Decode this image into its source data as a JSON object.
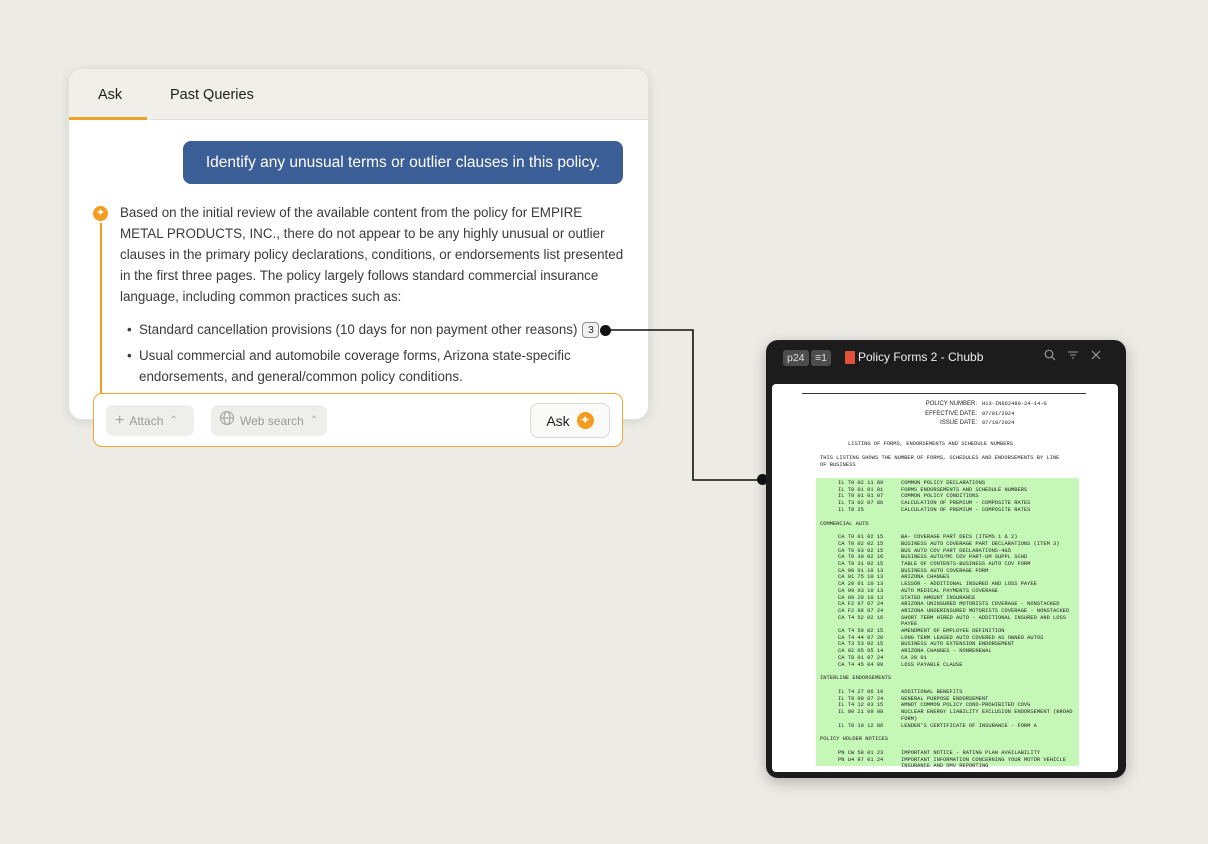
{
  "chat": {
    "tabs": [
      {
        "label": "Ask",
        "active": true
      },
      {
        "label": "Past Queries",
        "active": false
      }
    ],
    "user_query": "Identify any unusual terms or outlier clauses in this policy.",
    "response_intro": "Based on the initial review of the available content from the policy for EMPIRE METAL PRODUCTS, INC., there do not appear to be any highly unusual or outlier clauses in the primary policy declarations, conditions, or endorsements list presented in the first three pages. The policy largely follows standard commercial insurance language, including common practices such as:",
    "bullets": [
      {
        "text": "Standard cancellation provisions (10 days for non payment other reasons)",
        "citation": "3"
      },
      {
        "text": "Usual commercial and automobile coverage forms, Arizona state-specific endorsements, and general/common policy conditions.",
        "citation": ""
      }
    ],
    "input": {
      "attach_label": "Attach",
      "web_search_label": "Web search",
      "ask_label": "Ask"
    },
    "icons": {
      "ai_marker": "sparkle-icon",
      "ask": "sparkle-icon",
      "attach": "plus-icon",
      "web": "globe-icon"
    },
    "colors": {
      "accent": "#f39c20",
      "user_bubble": "#3b5e97"
    }
  },
  "viewer": {
    "page_badge": "p24",
    "section_badge": "1",
    "title": "Policy Forms 2 - Chubb",
    "icons": [
      "search-icon",
      "filter-icon",
      "close-icon"
    ],
    "doc": {
      "header": [
        {
          "label": "POLICY NUMBER:",
          "value": "H13-IN862480-24-14-G"
        },
        {
          "label": "EFFECTIVE DATE:",
          "value": "07/01/2024"
        },
        {
          "label": "ISSUE DATE:",
          "value": "07/10/2024"
        }
      ],
      "heading": "LISTING OF FORMS, ENDORSEMENTS AND SCHEDULE NUMBERS",
      "intro": "THIS LISTING SHOWS THE NUMBER OF FORMS, SCHEDULES AND ENDORSEMENTS BY LINE OF BUSINESS",
      "highlight_color": "#c5f7b7",
      "lines": [
        {
          "code": "IL T0 02 11 89",
          "desc": "COMMON POLICY DECLARATIONS"
        },
        {
          "code": "IL T8 01 01 01",
          "desc": "FORMS ENDORSEMENTS AND SCHEDULE NUMBERS"
        },
        {
          "code": "IL T0 01 01 07",
          "desc": "COMMON POLICY CONDITIONS"
        },
        {
          "code": "IL T3 02 07 86",
          "desc": "CALCULATION OF PREMIUM - COMPOSITE RATES"
        },
        {
          "code": "IL T8 25",
          "desc": "CALCULATION OF PREMIUM - COMPOSITE RATES"
        },
        {
          "section": "COMMERCIAL AUTO"
        },
        {
          "code": "CA T0 01 02 15",
          "desc": "BA- COVERAGE PART DECS (ITEMS 1 & 2)"
        },
        {
          "code": "CA T0 02 02 15",
          "desc": "BUSINESS AUTO COVERAGE PART DECLARATIONS (ITEM 3)"
        },
        {
          "code": "CA T0 03 02 15",
          "desc": "BUS AUTO COV PART DECLARATIONS-4&5"
        },
        {
          "code": "CA T0 30 02 16",
          "desc": "BUSINESS AUTO/MC COV PART-UM SUPPL SCHD"
        },
        {
          "code": "CA T0 31 02 15",
          "desc": "TABLE OF CONTENTS-BUSINESS AUTO COV FORM"
        },
        {
          "code": "CA 00 01 10 13",
          "desc": "BUSINESS AUTO COVERAGE FORM"
        },
        {
          "code": "CA 01 75 10 13",
          "desc": "ARIZONA CHANGES"
        },
        {
          "code": "CA 20 01 10 13",
          "desc": "LESSOR - ADDITIONAL INSURED AND LOSS PAYEE"
        },
        {
          "code": "CA 99 03 10 13",
          "desc": "AUTO MEDICAL PAYMENTS COVERAGE"
        },
        {
          "code": "CA 99 28 10 13",
          "desc": "STATED AMOUNT INSURANCE"
        },
        {
          "code": "CA F2 97 07 24",
          "desc": "ARIZONA UNINSURED MOTORISTS COVERAGE - NONSTACKED"
        },
        {
          "code": "CA F2 98 07 24",
          "desc": "ARIZONA UNDERINSURED MOTORISTS COVERAGE - NONSTACKED"
        },
        {
          "code": "CA T4 52 02 16",
          "desc": "SHORT TERM HIRED AUTO - ADDITIONAL INSURED AND LOSS PAYEE"
        },
        {
          "code": "CA T4 59 02 15",
          "desc": "AMENDMENT OF EMPLOYEE DEFINITION"
        },
        {
          "code": "CA T4 44 07 20",
          "desc": "LONG TERM LEASED AUTO COVERED AS OWNED AUTOS"
        },
        {
          "code": "CA T3 53 02 15",
          "desc": "BUSINESS AUTO EXTENSION ENDORSEMENT"
        },
        {
          "code": "CA 02 05 05 14",
          "desc": "ARIZONA CHANGES - NONRENEWAL"
        },
        {
          "code": "CA T8 01 07 24",
          "desc": "CA 20 01"
        },
        {
          "code": "CA T4 45 04 09",
          "desc": "LOSS PAYABLE CLAUSE"
        },
        {
          "section": "INTERLINE ENDORSEMENTS"
        },
        {
          "code": "IL T4 27 06 19",
          "desc": "ADDITIONAL BENEFITS"
        },
        {
          "code": "IL T8 00 07 24",
          "desc": "GENERAL PURPOSE ENDORSEMENT"
        },
        {
          "code": "IL T4 12 03 15",
          "desc": "AMNDT COMMON POLICY COND-PROHIBITED COVG"
        },
        {
          "code": "IL 00 21 09 08",
          "desc": "NUCLEAR ENERGY LIABILITY EXCLUSION ENDORSEMENT (BROAD FORM)"
        },
        {
          "code": "IL T0 10 12 86",
          "desc": "LENDER'S CERTIFICATE OF INSURANCE - FORM A"
        },
        {
          "section": "POLICY HOLDER NOTICES"
        },
        {
          "code": "PN CW 58 01 23",
          "desc": "IMPORTANT NOTICE - RATING PLAN AVAILABILITY"
        },
        {
          "code": "PN U4 97 01 24",
          "desc": "IMPORTANT INFORMATION CONCERNING YOUR MOTOR VEHICLE INSURANCE AND DMV REPORTING"
        }
      ]
    }
  }
}
